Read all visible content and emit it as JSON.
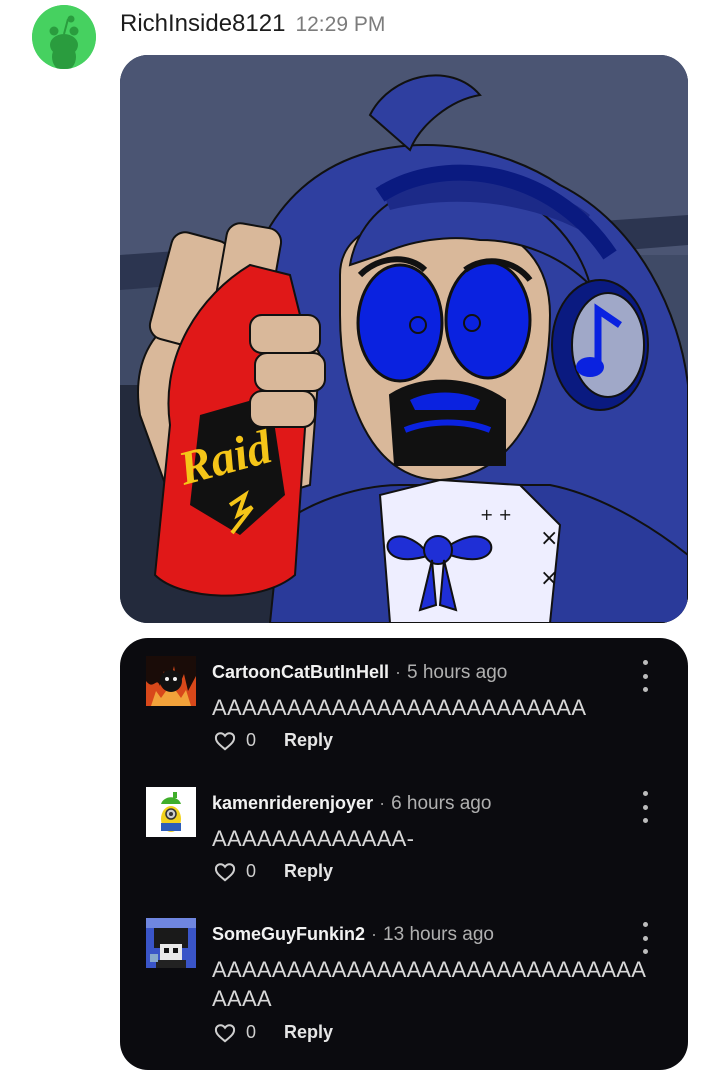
{
  "post": {
    "username": "RichInside8121",
    "time": "12:29 PM",
    "avatar_icon": "reddit-snoo-avatar",
    "image_text": "Raid"
  },
  "comments": [
    {
      "username": "CartoonCatButInHell",
      "separator": "·",
      "time": "5 hours ago",
      "text": "AAAAAAAAAAAAAAAAAAAAAAAAA",
      "likes": "0",
      "reply_label": "Reply",
      "avatar_icon": "fiery-cartoon-cat-avatar"
    },
    {
      "username": "kamenriderenjoyer",
      "separator": "·",
      "time": "6 hours ago",
      "text": "AAAAAAAAAAAAA-",
      "likes": "0",
      "reply_label": "Reply",
      "avatar_icon": "minion-character-avatar"
    },
    {
      "username": "SomeGuyFunkin2",
      "separator": "·",
      "time": "13 hours ago",
      "text": "AAAAAAAAAAAAAAAAAAAAAAAAAAAAAAAAA",
      "likes": "0",
      "reply_label": "Reply",
      "avatar_icon": "pixel-character-avatar"
    }
  ],
  "colors": {
    "avatar_green": "#46d160",
    "comments_bg": "#0b0b0f",
    "art_hair_blue": "#2f3fa0",
    "art_eye_blue": "#0a22e0",
    "can_red": "#e01818"
  }
}
